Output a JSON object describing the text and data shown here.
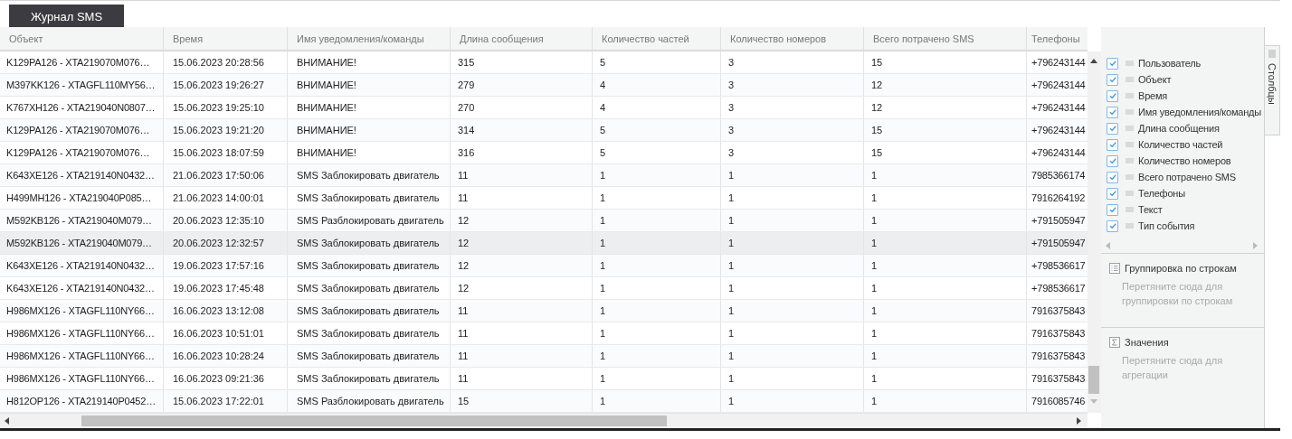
{
  "tabs": [
    {
      "label": "Журнал SMS",
      "selected": true
    }
  ],
  "table": {
    "columns": [
      "Объект",
      "Время",
      "Имя уведомления/команды",
      "Длина сообщения",
      "Количество частей",
      "Количество номеров",
      "Всего потрачено SMS",
      "Телефоны"
    ],
    "rows": [
      {
        "cells": [
          "K129PA126 - XTA219070M076…",
          "15.06.2023 20:28:56",
          "ВНИМАНИЕ!",
          "315",
          "5",
          "3",
          "15",
          "+796243144"
        ],
        "selected": false
      },
      {
        "cells": [
          "M397KK126 - XTAGFL110MY56…",
          "15.06.2023 19:26:27",
          "ВНИМАНИЕ!",
          "279",
          "4",
          "3",
          "12",
          "+796243144"
        ],
        "selected": false
      },
      {
        "cells": [
          "K767XH126 - XTA219040N0807…",
          "15.06.2023 19:25:10",
          "ВНИМАНИЕ!",
          "270",
          "4",
          "3",
          "12",
          "+796243144"
        ],
        "selected": false
      },
      {
        "cells": [
          "K129PA126 - XTA219070M076…",
          "15.06.2023 19:21:20",
          "ВНИМАНИЕ!",
          "314",
          "5",
          "3",
          "15",
          "+796243144"
        ],
        "selected": false
      },
      {
        "cells": [
          "K129PA126 - XTA219070M076…",
          "15.06.2023 18:07:59",
          "ВНИМАНИЕ!",
          "316",
          "5",
          "3",
          "15",
          "+796243144"
        ],
        "selected": false
      },
      {
        "cells": [
          "K643XE126 - XTA219140N0432…",
          "21.06.2023 17:50:06",
          "SMS Заблокировать двигатель",
          "11",
          "1",
          "1",
          "1",
          "7985366174"
        ],
        "selected": false
      },
      {
        "cells": [
          "H499MH126 - XTA219040P085…",
          "21.06.2023 14:00:01",
          "SMS Заблокировать двигатель",
          "11",
          "1",
          "1",
          "1",
          "7916264192"
        ],
        "selected": false
      },
      {
        "cells": [
          "M592KB126 - XTA219040M079…",
          "20.06.2023 12:35:10",
          "SMS Разблокировать двигатель",
          "12",
          "1",
          "1",
          "1",
          "+791505947"
        ],
        "selected": false
      },
      {
        "cells": [
          "M592KB126 - XTA219040M079…",
          "20.06.2023 12:32:57",
          "SMS Заблокировать двигатель",
          "12",
          "1",
          "1",
          "1",
          "+791505947"
        ],
        "selected": true
      },
      {
        "cells": [
          "K643XE126 - XTA219140N0432…",
          "19.06.2023 17:57:16",
          "SMS Заблокировать двигатель",
          "12",
          "1",
          "1",
          "1",
          "+798536617"
        ],
        "selected": false
      },
      {
        "cells": [
          "K643XE126 - XTA219140N0432…",
          "19.06.2023 17:45:48",
          "SMS Заблокировать двигатель",
          "12",
          "1",
          "1",
          "1",
          "+798536617"
        ],
        "selected": false
      },
      {
        "cells": [
          "H986MX126 - XTAGFL110NY66…",
          "16.06.2023 13:12:08",
          "SMS Заблокировать двигатель",
          "11",
          "1",
          "1",
          "1",
          "7916375843"
        ],
        "selected": false
      },
      {
        "cells": [
          "H986MX126 - XTAGFL110NY66…",
          "16.06.2023 10:51:01",
          "SMS Заблокировать двигатель",
          "11",
          "1",
          "1",
          "1",
          "7916375843"
        ],
        "selected": false
      },
      {
        "cells": [
          "H986MX126 - XTAGFL110NY66…",
          "16.06.2023 10:28:24",
          "SMS Заблокировать двигатель",
          "11",
          "1",
          "1",
          "1",
          "7916375843"
        ],
        "selected": false
      },
      {
        "cells": [
          "H986MX126 - XTAGFL110NY66…",
          "16.06.2023 09:21:36",
          "SMS Заблокировать двигатель",
          "11",
          "1",
          "1",
          "1",
          "7916375843"
        ],
        "selected": false
      },
      {
        "cells": [
          "H812OP126 - XTA219140P0452…",
          "15.06.2023 17:22:01",
          "SMS Разблокировать двигатель",
          "15",
          "1",
          "1",
          "1",
          "7916085746"
        ],
        "selected": false
      }
    ]
  },
  "field_panel": {
    "columns": [
      {
        "label": "Пользователь",
        "checked": true
      },
      {
        "label": "Объект",
        "checked": true
      },
      {
        "label": "Время",
        "checked": true
      },
      {
        "label": "Имя уведомления/команды",
        "checked": true
      },
      {
        "label": "Длина сообщения",
        "checked": true
      },
      {
        "label": "Количество частей",
        "checked": true
      },
      {
        "label": "Количество номеров",
        "checked": true
      },
      {
        "label": "Всего потрачено SMS",
        "checked": true
      },
      {
        "label": "Телефоны",
        "checked": true
      },
      {
        "label": "Текст",
        "checked": true
      },
      {
        "label": "Тип события",
        "checked": true
      }
    ],
    "sections": [
      {
        "kind": "rows",
        "title": "Группировка по строкам",
        "hint": "Перетяните сюда для группировки по строкам"
      },
      {
        "kind": "values",
        "title": "Значения",
        "hint": "Перетяните сюда для агрегации"
      }
    ],
    "side_tab": "Столбцы"
  }
}
